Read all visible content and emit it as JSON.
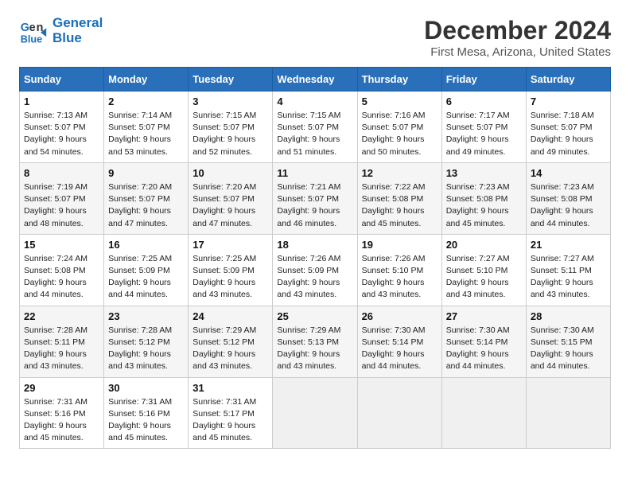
{
  "header": {
    "logo_line1": "General",
    "logo_line2": "Blue",
    "title": "December 2024",
    "subtitle": "First Mesa, Arizona, United States"
  },
  "weekdays": [
    "Sunday",
    "Monday",
    "Tuesday",
    "Wednesday",
    "Thursday",
    "Friday",
    "Saturday"
  ],
  "weeks": [
    [
      {
        "day": 1,
        "sunrise": "7:13 AM",
        "sunset": "5:07 PM",
        "daylight": "9 hours and 54 minutes."
      },
      {
        "day": 2,
        "sunrise": "7:14 AM",
        "sunset": "5:07 PM",
        "daylight": "9 hours and 53 minutes."
      },
      {
        "day": 3,
        "sunrise": "7:15 AM",
        "sunset": "5:07 PM",
        "daylight": "9 hours and 52 minutes."
      },
      {
        "day": 4,
        "sunrise": "7:15 AM",
        "sunset": "5:07 PM",
        "daylight": "9 hours and 51 minutes."
      },
      {
        "day": 5,
        "sunrise": "7:16 AM",
        "sunset": "5:07 PM",
        "daylight": "9 hours and 50 minutes."
      },
      {
        "day": 6,
        "sunrise": "7:17 AM",
        "sunset": "5:07 PM",
        "daylight": "9 hours and 49 minutes."
      },
      {
        "day": 7,
        "sunrise": "7:18 AM",
        "sunset": "5:07 PM",
        "daylight": "9 hours and 49 minutes."
      }
    ],
    [
      {
        "day": 8,
        "sunrise": "7:19 AM",
        "sunset": "5:07 PM",
        "daylight": "9 hours and 48 minutes."
      },
      {
        "day": 9,
        "sunrise": "7:20 AM",
        "sunset": "5:07 PM",
        "daylight": "9 hours and 47 minutes."
      },
      {
        "day": 10,
        "sunrise": "7:20 AM",
        "sunset": "5:07 PM",
        "daylight": "9 hours and 47 minutes."
      },
      {
        "day": 11,
        "sunrise": "7:21 AM",
        "sunset": "5:07 PM",
        "daylight": "9 hours and 46 minutes."
      },
      {
        "day": 12,
        "sunrise": "7:22 AM",
        "sunset": "5:08 PM",
        "daylight": "9 hours and 45 minutes."
      },
      {
        "day": 13,
        "sunrise": "7:23 AM",
        "sunset": "5:08 PM",
        "daylight": "9 hours and 45 minutes."
      },
      {
        "day": 14,
        "sunrise": "7:23 AM",
        "sunset": "5:08 PM",
        "daylight": "9 hours and 44 minutes."
      }
    ],
    [
      {
        "day": 15,
        "sunrise": "7:24 AM",
        "sunset": "5:08 PM",
        "daylight": "9 hours and 44 minutes."
      },
      {
        "day": 16,
        "sunrise": "7:25 AM",
        "sunset": "5:09 PM",
        "daylight": "9 hours and 44 minutes."
      },
      {
        "day": 17,
        "sunrise": "7:25 AM",
        "sunset": "5:09 PM",
        "daylight": "9 hours and 43 minutes."
      },
      {
        "day": 18,
        "sunrise": "7:26 AM",
        "sunset": "5:09 PM",
        "daylight": "9 hours and 43 minutes."
      },
      {
        "day": 19,
        "sunrise": "7:26 AM",
        "sunset": "5:10 PM",
        "daylight": "9 hours and 43 minutes."
      },
      {
        "day": 20,
        "sunrise": "7:27 AM",
        "sunset": "5:10 PM",
        "daylight": "9 hours and 43 minutes."
      },
      {
        "day": 21,
        "sunrise": "7:27 AM",
        "sunset": "5:11 PM",
        "daylight": "9 hours and 43 minutes."
      }
    ],
    [
      {
        "day": 22,
        "sunrise": "7:28 AM",
        "sunset": "5:11 PM",
        "daylight": "9 hours and 43 minutes."
      },
      {
        "day": 23,
        "sunrise": "7:28 AM",
        "sunset": "5:12 PM",
        "daylight": "9 hours and 43 minutes."
      },
      {
        "day": 24,
        "sunrise": "7:29 AM",
        "sunset": "5:12 PM",
        "daylight": "9 hours and 43 minutes."
      },
      {
        "day": 25,
        "sunrise": "7:29 AM",
        "sunset": "5:13 PM",
        "daylight": "9 hours and 43 minutes."
      },
      {
        "day": 26,
        "sunrise": "7:30 AM",
        "sunset": "5:14 PM",
        "daylight": "9 hours and 44 minutes."
      },
      {
        "day": 27,
        "sunrise": "7:30 AM",
        "sunset": "5:14 PM",
        "daylight": "9 hours and 44 minutes."
      },
      {
        "day": 28,
        "sunrise": "7:30 AM",
        "sunset": "5:15 PM",
        "daylight": "9 hours and 44 minutes."
      }
    ],
    [
      {
        "day": 29,
        "sunrise": "7:31 AM",
        "sunset": "5:16 PM",
        "daylight": "9 hours and 45 minutes."
      },
      {
        "day": 30,
        "sunrise": "7:31 AM",
        "sunset": "5:16 PM",
        "daylight": "9 hours and 45 minutes."
      },
      {
        "day": 31,
        "sunrise": "7:31 AM",
        "sunset": "5:17 PM",
        "daylight": "9 hours and 45 minutes."
      },
      null,
      null,
      null,
      null
    ]
  ]
}
